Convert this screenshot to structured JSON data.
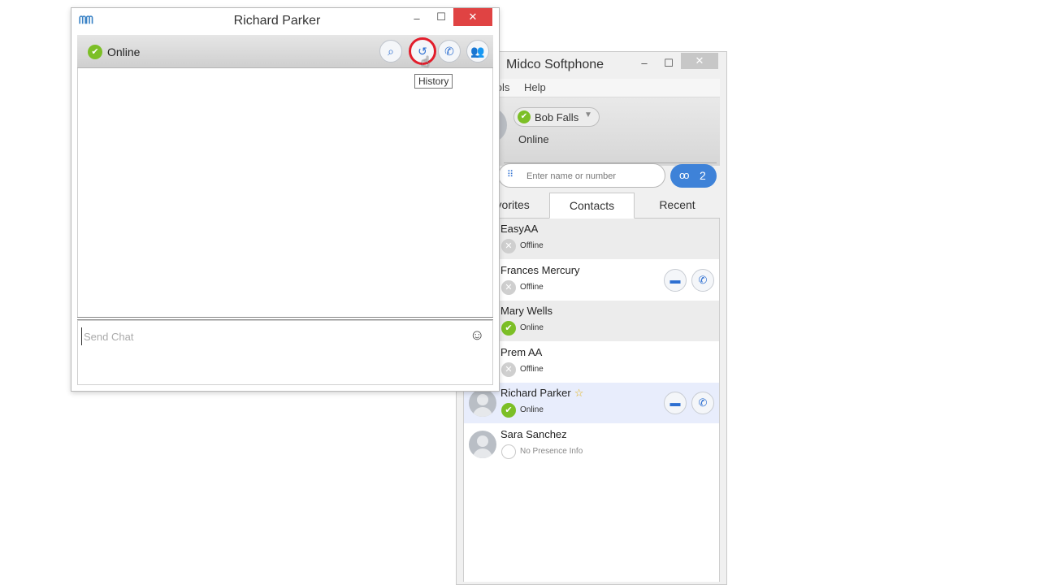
{
  "softphone": {
    "title": "Midco Softphone",
    "min_glyph": "–",
    "max_glyph": "☐",
    "close_glyph": "✕",
    "menu": {
      "tools": "Tools",
      "help": "Help"
    },
    "user": {
      "name": "Bob Falls",
      "status": "Online"
    },
    "search": {
      "placeholder": "Enter name or number"
    },
    "voicemail": {
      "icon": "oo",
      "count": "2"
    },
    "tabs": {
      "favorites": "Favorites",
      "contacts": "Contacts",
      "recent": "Recent"
    },
    "contacts": [
      {
        "name": "EasyAA",
        "status": "Offline"
      },
      {
        "name": "Frances Mercury",
        "status": "Offline"
      },
      {
        "name": "Mary Wells",
        "status": "Online"
      },
      {
        "name": "Prem AA",
        "status": "Offline"
      },
      {
        "name": "Richard Parker",
        "status": "Online",
        "favorite": "☆"
      },
      {
        "name": "Sara Sanchez",
        "status": "No Presence Info"
      }
    ]
  },
  "chat": {
    "logo": "ᗰᗰ",
    "title": "Richard Parker",
    "min_glyph": "–",
    "max_glyph": "☐",
    "close_glyph": "✕",
    "status": "Online",
    "input_placeholder": "Send Chat",
    "emoji": "☺",
    "toolbar_icons": {
      "attach": "paperclip-icon",
      "history": "history-icon",
      "call": "phone-icon",
      "contacts": "add-contact-icon"
    },
    "tooltip": "History"
  },
  "colors": {
    "online": "#7cbf26",
    "offline": "#cfcfcf",
    "accent_blue": "#3e82d8",
    "close_red": "#e04343",
    "highlight_ring": "#e21d2b"
  }
}
